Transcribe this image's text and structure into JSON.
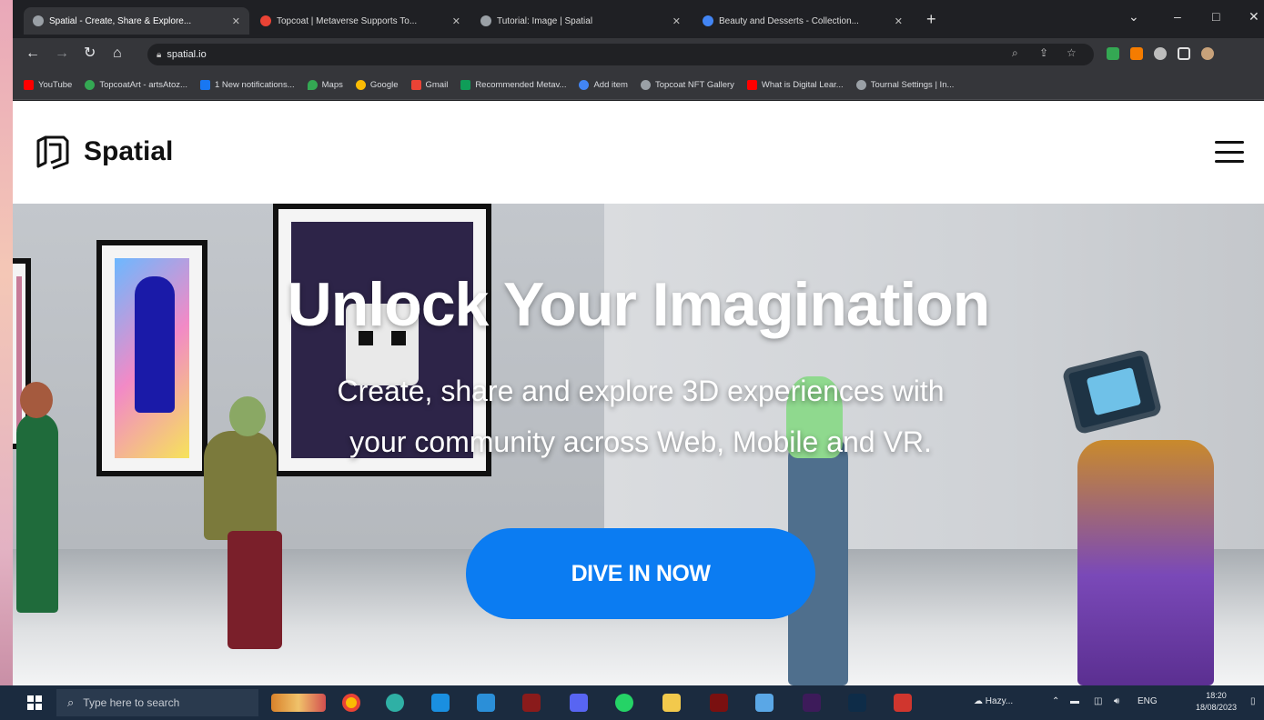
{
  "browser": {
    "tabs": [
      {
        "title": "Spatial - Create, Share & Explore...",
        "color": "#9aa0a6",
        "active": true
      },
      {
        "title": "Topcoat | Metaverse Supports To...",
        "color": "#ea4335",
        "active": false
      },
      {
        "title": "Tutorial: Image | Spatial",
        "color": "#9aa0a6",
        "active": false
      },
      {
        "title": "Beauty and Desserts - Collection...",
        "color": "#4285f4",
        "active": false
      }
    ],
    "new_tab": "+",
    "window_controls": {
      "minimize": "–",
      "maximize": "□",
      "close": "✕"
    },
    "url": "spatial.io",
    "bookmarks": [
      {
        "label": "YouTube",
        "color": "#ff0000"
      },
      {
        "label": "TopcoatArt - artsAtoz...",
        "color": "#34a853"
      },
      {
        "label": "1 New notifications...",
        "color": "#1877f2"
      },
      {
        "label": "Maps",
        "color": "#34a853"
      },
      {
        "label": "Google",
        "color": "#fbbc04"
      },
      {
        "label": "Gmail",
        "color": "#ea4335"
      },
      {
        "label": "Recommended Metav...",
        "color": "#0f9d58"
      },
      {
        "label": "Add item",
        "color": "#4285f4"
      },
      {
        "label": "Topcoat NFT Gallery",
        "color": "#9aa0a6"
      },
      {
        "label": "What is Digital Lear...",
        "color": "#ff0000"
      },
      {
        "label": "Tournal Settings | In...",
        "color": "#9aa0a6"
      }
    ]
  },
  "site": {
    "brand": "Spatial",
    "hero": {
      "title": "Unlock Your Imagination",
      "subtitle_line1": "Create, share and explore 3D experiences with",
      "subtitle_line2": "your community across Web, Mobile and VR.",
      "cta": "DIVE IN NOW"
    },
    "accent": "#0b7cf2"
  },
  "taskbar": {
    "search_placeholder": "Type here to search",
    "weather": "Hazy...",
    "language": "ENG",
    "time": "18:20",
    "date": "18/08/2023"
  }
}
